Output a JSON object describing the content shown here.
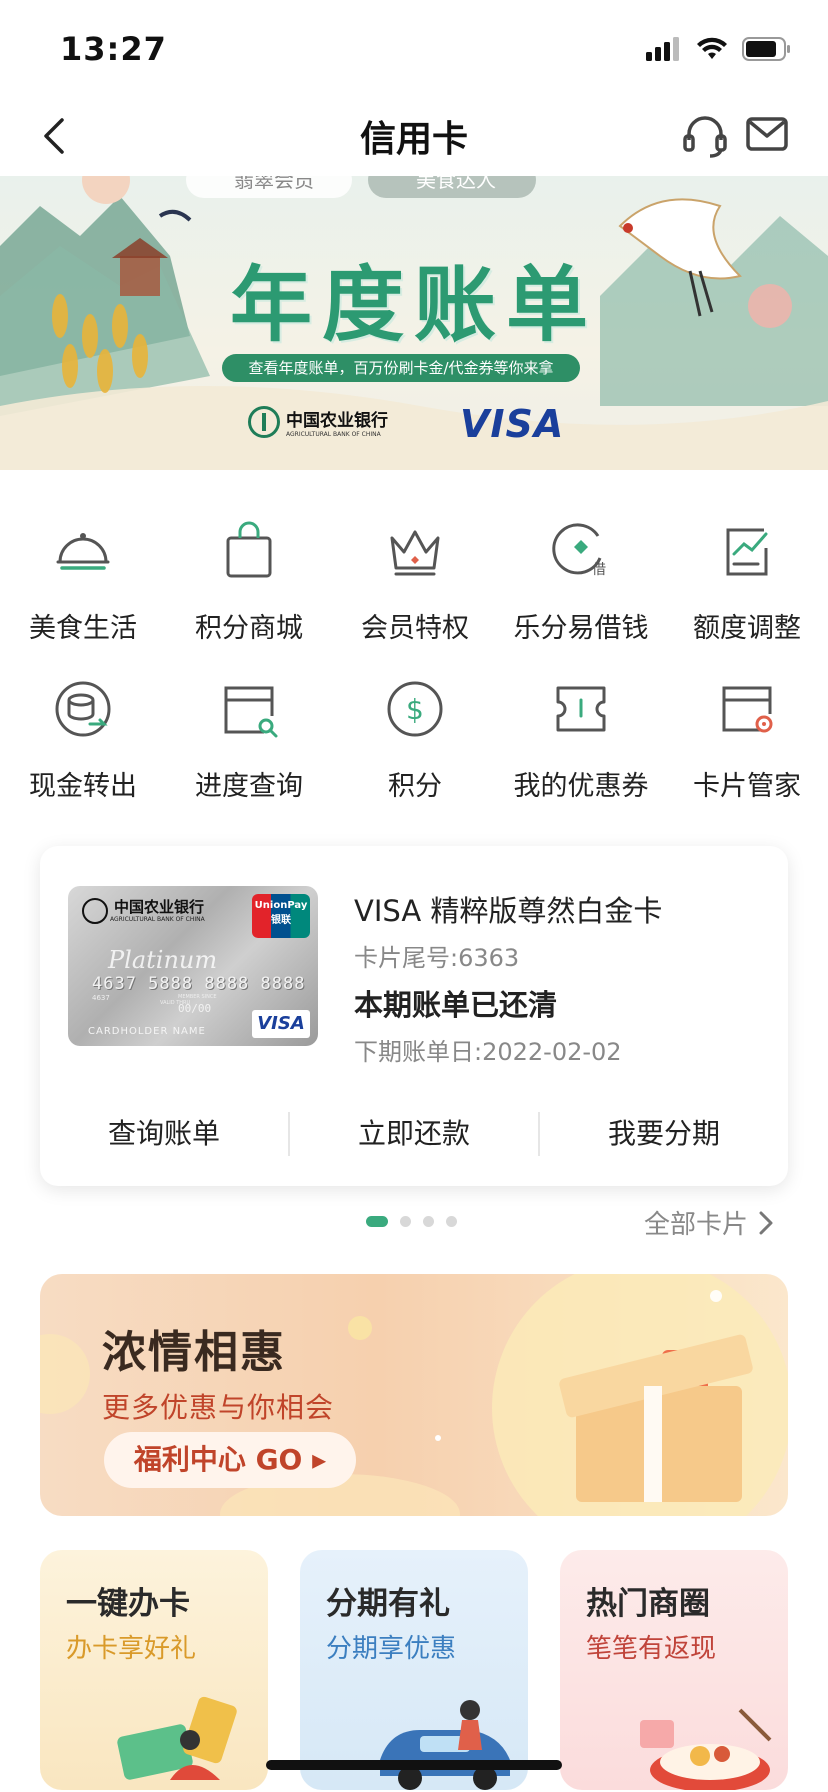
{
  "status_bar": {
    "time": "13:27"
  },
  "nav": {
    "title": "信用卡"
  },
  "banner": {
    "chip_member": "翡翠会员",
    "chip_food": "美食达人",
    "title": "年度账单",
    "subtitle": "查看年度账单，百万份刷卡金/代金券等你来拿",
    "bank_name": "中国农业银行",
    "bank_name_en": "AGRICULTURAL BANK OF CHINA",
    "visa": "VISA"
  },
  "grid": {
    "items": [
      {
        "label": "美食生活",
        "icon": "dining-cloche-icon"
      },
      {
        "label": "积分商城",
        "icon": "shopping-bag-icon"
      },
      {
        "label": "会员特权",
        "icon": "crown-icon"
      },
      {
        "label": "乐分易借钱",
        "icon": "loan-icon"
      },
      {
        "label": "额度调整",
        "icon": "chart-adjust-icon"
      },
      {
        "label": "现金转出",
        "icon": "coin-transfer-icon"
      },
      {
        "label": "进度查询",
        "icon": "progress-search-icon"
      },
      {
        "label": "积分",
        "icon": "dollar-circle-icon"
      },
      {
        "label": "我的优惠券",
        "icon": "coupon-icon"
      },
      {
        "label": "卡片管家",
        "icon": "card-settings-icon"
      }
    ]
  },
  "card": {
    "image_bank": "中国农业银行",
    "image_bank_en": "AGRICULTURAL BANK OF CHINA",
    "image_unionpay": "UnionPay 银联",
    "image_platinum": "Platinum",
    "image_number": "4637 5888 8888 8888",
    "image_prefix": "4637",
    "image_valid_label": "VALID THRU",
    "image_member_label": "MEMBER SINCE",
    "image_expiry": "00/00",
    "image_holder": "CARDHOLDER NAME",
    "image_visa": "VISA",
    "name": "VISA 精粹版尊然白金卡",
    "tail": "卡片尾号:6363",
    "status": "本期账单已还清",
    "next_bill": "下期账单日:2022-02-02",
    "actions": [
      "查询账单",
      "立即还款",
      "我要分期"
    ],
    "pager_count": 4,
    "pager_active": 1
  },
  "all_cards": "全部卡片",
  "promo": {
    "title": "浓情相惠",
    "subtitle": "更多优惠与你相会",
    "button": "福利中心 GO ▸"
  },
  "mini_cards": [
    {
      "title": "一键办卡",
      "subtitle": "办卡享好礼"
    },
    {
      "title": "分期有礼",
      "subtitle": "分期享优惠"
    },
    {
      "title": "热门商圈",
      "subtitle": "笔笔有返现"
    }
  ],
  "colors": {
    "accent_green": "#3aaa7e",
    "banner_green": "#2c9a72",
    "promo_red": "#c0442a",
    "visa_blue": "#1a3f9b"
  }
}
